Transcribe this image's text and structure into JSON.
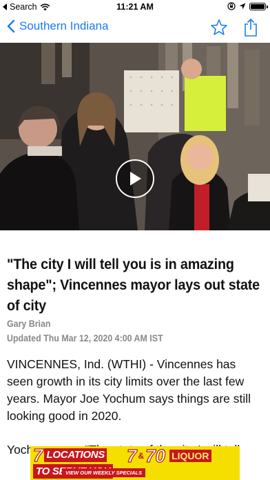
{
  "status_bar": {
    "back_app": "Search",
    "time": "11:21 AM",
    "battery_level": 1.0
  },
  "nav": {
    "back_label": "Southern Indiana",
    "back_icon": "chevron-left-icon",
    "favorite_icon": "star-outline-icon",
    "share_icon": "share-icon",
    "accent_color": "#1a7cf0"
  },
  "video": {
    "play_icon": "play-icon"
  },
  "article": {
    "headline": "\"The city I will tell you is in amazing shape\"; Vincennes mayor lays out state of city",
    "author": "Gary Brian",
    "updated": "Updated Thu Mar 12, 2020 4:00 AM IST",
    "paragraphs": [
      "VINCENNES, Ind. (WTHI) - Vincennes has seen growth in its city limits over the last few years. Mayor Joe Yochum says things are still looking good in 2020.",
      "Yochum says, \"The state of the city I will tell"
    ]
  },
  "ad": {
    "left_number": "7",
    "left_line1": "LOCATIONS",
    "left_line2": "TO SERVE YOU",
    "logo_left": "7",
    "logo_amp": "&",
    "logo_right": "70",
    "logo_word": "LIQUOR",
    "cta": "VIEW OUR WEEKLY SPECIALS",
    "background_color": "#f5df00",
    "accent_color": "#c8161d"
  }
}
